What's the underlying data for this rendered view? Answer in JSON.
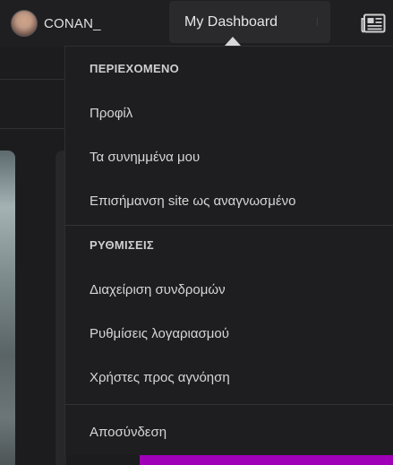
{
  "header": {
    "username": "CONAN_",
    "dashboard_label": "My Dashboard"
  },
  "menu": {
    "sections": [
      {
        "heading": "ΠΕΡΙΕΧΟΜΕΝΟ",
        "items": [
          "Προφίλ",
          "Τα συνημμένα μου",
          "Επισήμανση site ως αναγνωσμένο"
        ]
      },
      {
        "heading": "ΡΥΘΜΙΣΕΙΣ",
        "items": [
          "Διαχείριση συνδρομών",
          "Ρυθμίσεις λογαριασμού",
          "Χρήστες προς αγνόηση"
        ]
      }
    ],
    "logout": "Αποσύνδεση"
  },
  "icons": {
    "avatar": "user-avatar",
    "news": "newspaper-icon"
  },
  "colors": {
    "background": "#1c1c1e",
    "menu_background": "#1e1e20",
    "accent_bar": "#a000b8"
  }
}
